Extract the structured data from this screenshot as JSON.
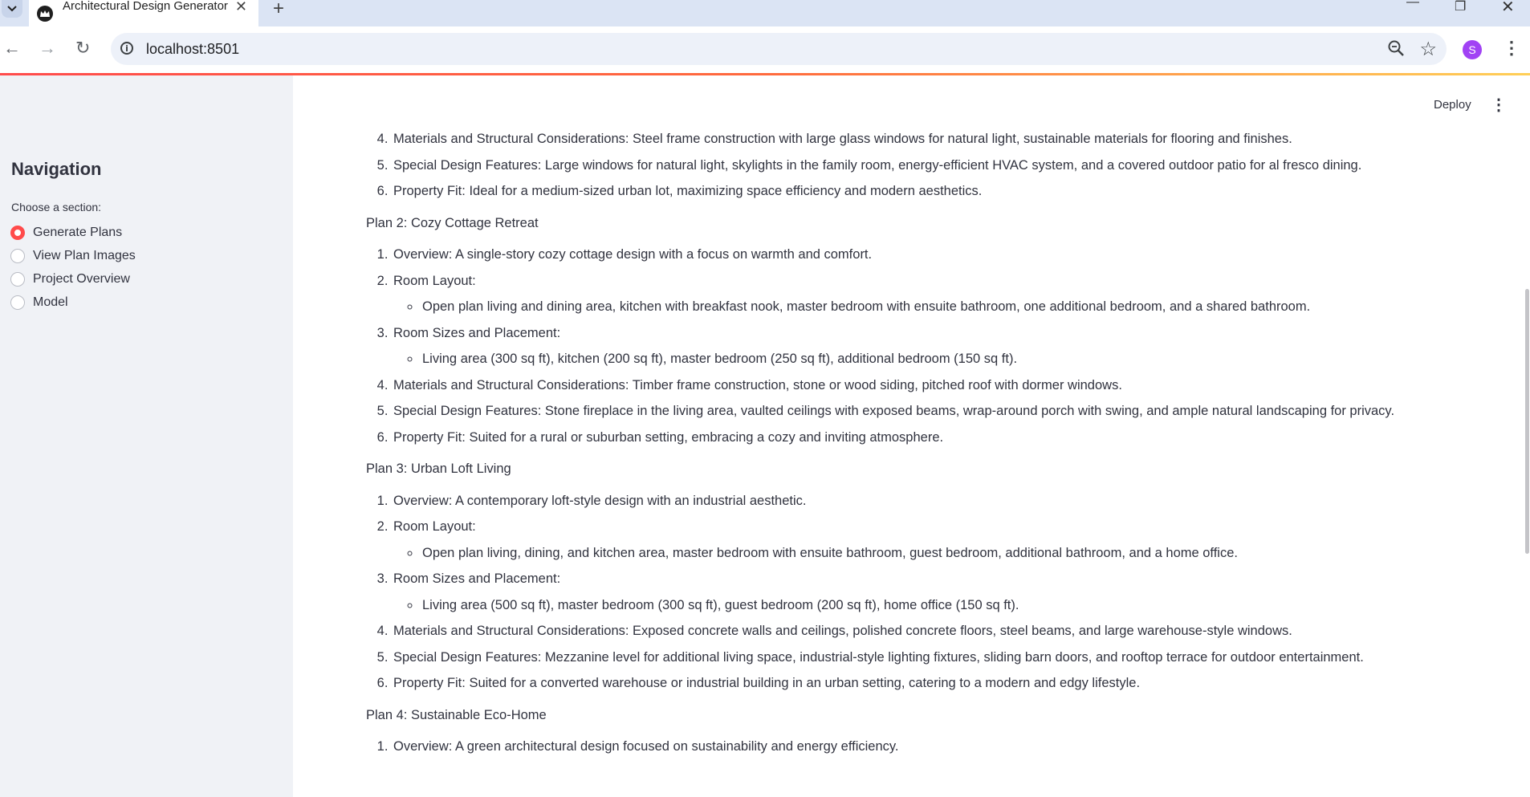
{
  "browser": {
    "tab_title": "Architectural Design Generator",
    "url": "localhost:8501",
    "avatar_letter": "S"
  },
  "sidebar": {
    "title": "Navigation",
    "label": "Choose a section:",
    "options": [
      {
        "label": "Generate Plans",
        "selected": true
      },
      {
        "label": "View Plan Images",
        "selected": false
      },
      {
        "label": "Project Overview",
        "selected": false
      },
      {
        "label": "Model",
        "selected": false
      }
    ]
  },
  "header": {
    "deploy_label": "Deploy"
  },
  "plan1_tail": [
    "Materials and Structural Considerations: Steel frame construction with large glass windows for natural light, sustainable materials for flooring and finishes.",
    "Special Design Features: Large windows for natural light, skylights in the family room, energy-efficient HVAC system, and a covered outdoor patio for al fresco dining.",
    "Property Fit: Ideal for a medium-sized urban lot, maximizing space efficiency and modern aesthetics."
  ],
  "plan2": {
    "title": "Plan 2: Cozy Cottage Retreat",
    "overview": "Overview: A single-story cozy cottage design with a focus on warmth and comfort.",
    "room_layout": "Room Layout:",
    "room_layout_detail": "Open plan living and dining area, kitchen with breakfast nook, master bedroom with ensuite bathroom, one additional bedroom, and a shared bathroom.",
    "room_sizes": "Room Sizes and Placement:",
    "room_sizes_detail": "Living area (300 sq ft), kitchen (200 sq ft), master bedroom (250 sq ft), additional bedroom (150 sq ft).",
    "materials": "Materials and Structural Considerations: Timber frame construction, stone or wood siding, pitched roof with dormer windows.",
    "features": "Special Design Features: Stone fireplace in the living area, vaulted ceilings with exposed beams, wrap-around porch with swing, and ample natural landscaping for privacy.",
    "fit": "Property Fit: Suited for a rural or suburban setting, embracing a cozy and inviting atmosphere."
  },
  "plan3": {
    "title": "Plan 3: Urban Loft Living",
    "overview": "Overview: A contemporary loft-style design with an industrial aesthetic.",
    "room_layout": "Room Layout:",
    "room_layout_detail": "Open plan living, dining, and kitchen area, master bedroom with ensuite bathroom, guest bedroom, additional bathroom, and a home office.",
    "room_sizes": "Room Sizes and Placement:",
    "room_sizes_detail": "Living area (500 sq ft), master bedroom (300 sq ft), guest bedroom (200 sq ft), home office (150 sq ft).",
    "materials": "Materials and Structural Considerations: Exposed concrete walls and ceilings, polished concrete floors, steel beams, and large warehouse-style windows.",
    "features": "Special Design Features: Mezzanine level for additional living space, industrial-style lighting fixtures, sliding barn doors, and rooftop terrace for outdoor entertainment.",
    "fit": "Property Fit: Suited for a converted warehouse or industrial building in an urban setting, catering to a modern and edgy lifestyle."
  },
  "plan4": {
    "title": "Plan 4: Sustainable Eco-Home",
    "overview": "Overview: A green architectural design focused on sustainability and energy efficiency."
  }
}
